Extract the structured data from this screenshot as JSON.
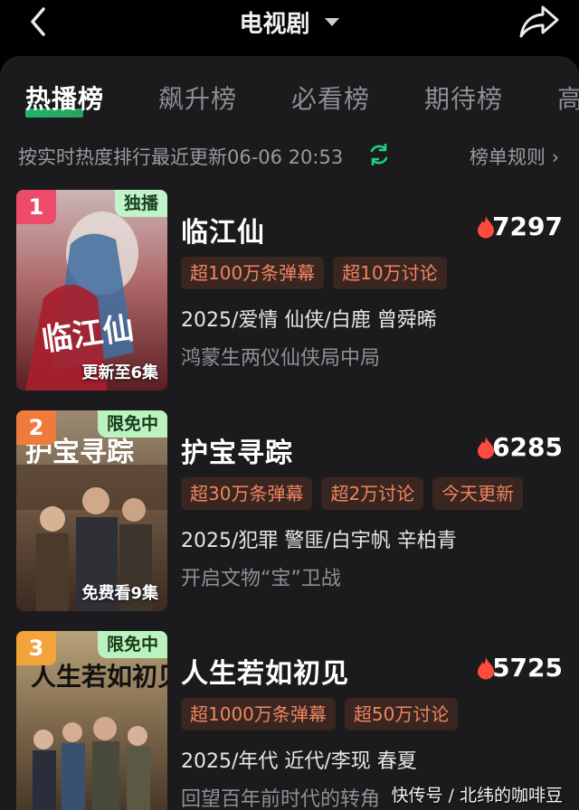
{
  "header": {
    "title": "电视剧",
    "back_icon": "chevron-left-icon",
    "share_icon": "share-icon",
    "dropdown_icon": "caret-down-icon"
  },
  "tabs": [
    {
      "label": "热播榜",
      "active": true
    },
    {
      "label": "飙升榜",
      "active": false
    },
    {
      "label": "必看榜",
      "active": false
    },
    {
      "label": "期待榜",
      "active": false
    },
    {
      "label": "高",
      "active": false
    }
  ],
  "subheader": {
    "text": "按实时热度排行最近更新06-06 20:53",
    "rules_label": "榜单规则 ›",
    "refresh_icon": "refresh-icon"
  },
  "list": [
    {
      "rank": "1",
      "badge": "独播",
      "poster_caption": "更新至6集",
      "poster_title": "临江仙",
      "title": "临江仙",
      "heat": "7297",
      "tags": [
        "超100万条弹幕",
        "超10万讨论"
      ],
      "meta": "2025/爱情 仙侠/白鹿 曾舜晞",
      "desc": "鸿蒙生两仪仙侠局中局"
    },
    {
      "rank": "2",
      "badge": "限免中",
      "poster_caption": "免费看9集",
      "poster_title": "护宝寻踪",
      "title": "护宝寻踪",
      "heat": "6285",
      "tags": [
        "超30万条弹幕",
        "超2万讨论",
        "今天更新"
      ],
      "meta": "2025/犯罪 警匪/白宇帆 辛柏青",
      "desc": "开启文物“宝”卫战"
    },
    {
      "rank": "3",
      "badge": "限免中",
      "poster_caption": "",
      "poster_title": "人生若如初见",
      "title": "人生若如初见",
      "heat": "5725",
      "tags": [
        "超1000万条弹幕",
        "超50万讨论"
      ],
      "meta": "2025/年代 近代/李现 春夏",
      "desc": "回望百年前时代的转角"
    }
  ],
  "watermark": "快传号 / 北纬的咖啡豆",
  "colors": {
    "accent_green": "#1fd07b",
    "tag_text": "#f08460",
    "tag_bg": "#3a2620",
    "rank1": "#ee4a6a",
    "rank2": "#f07a3c",
    "rank3": "#f2a33a",
    "flame": "#ff4a3d"
  }
}
